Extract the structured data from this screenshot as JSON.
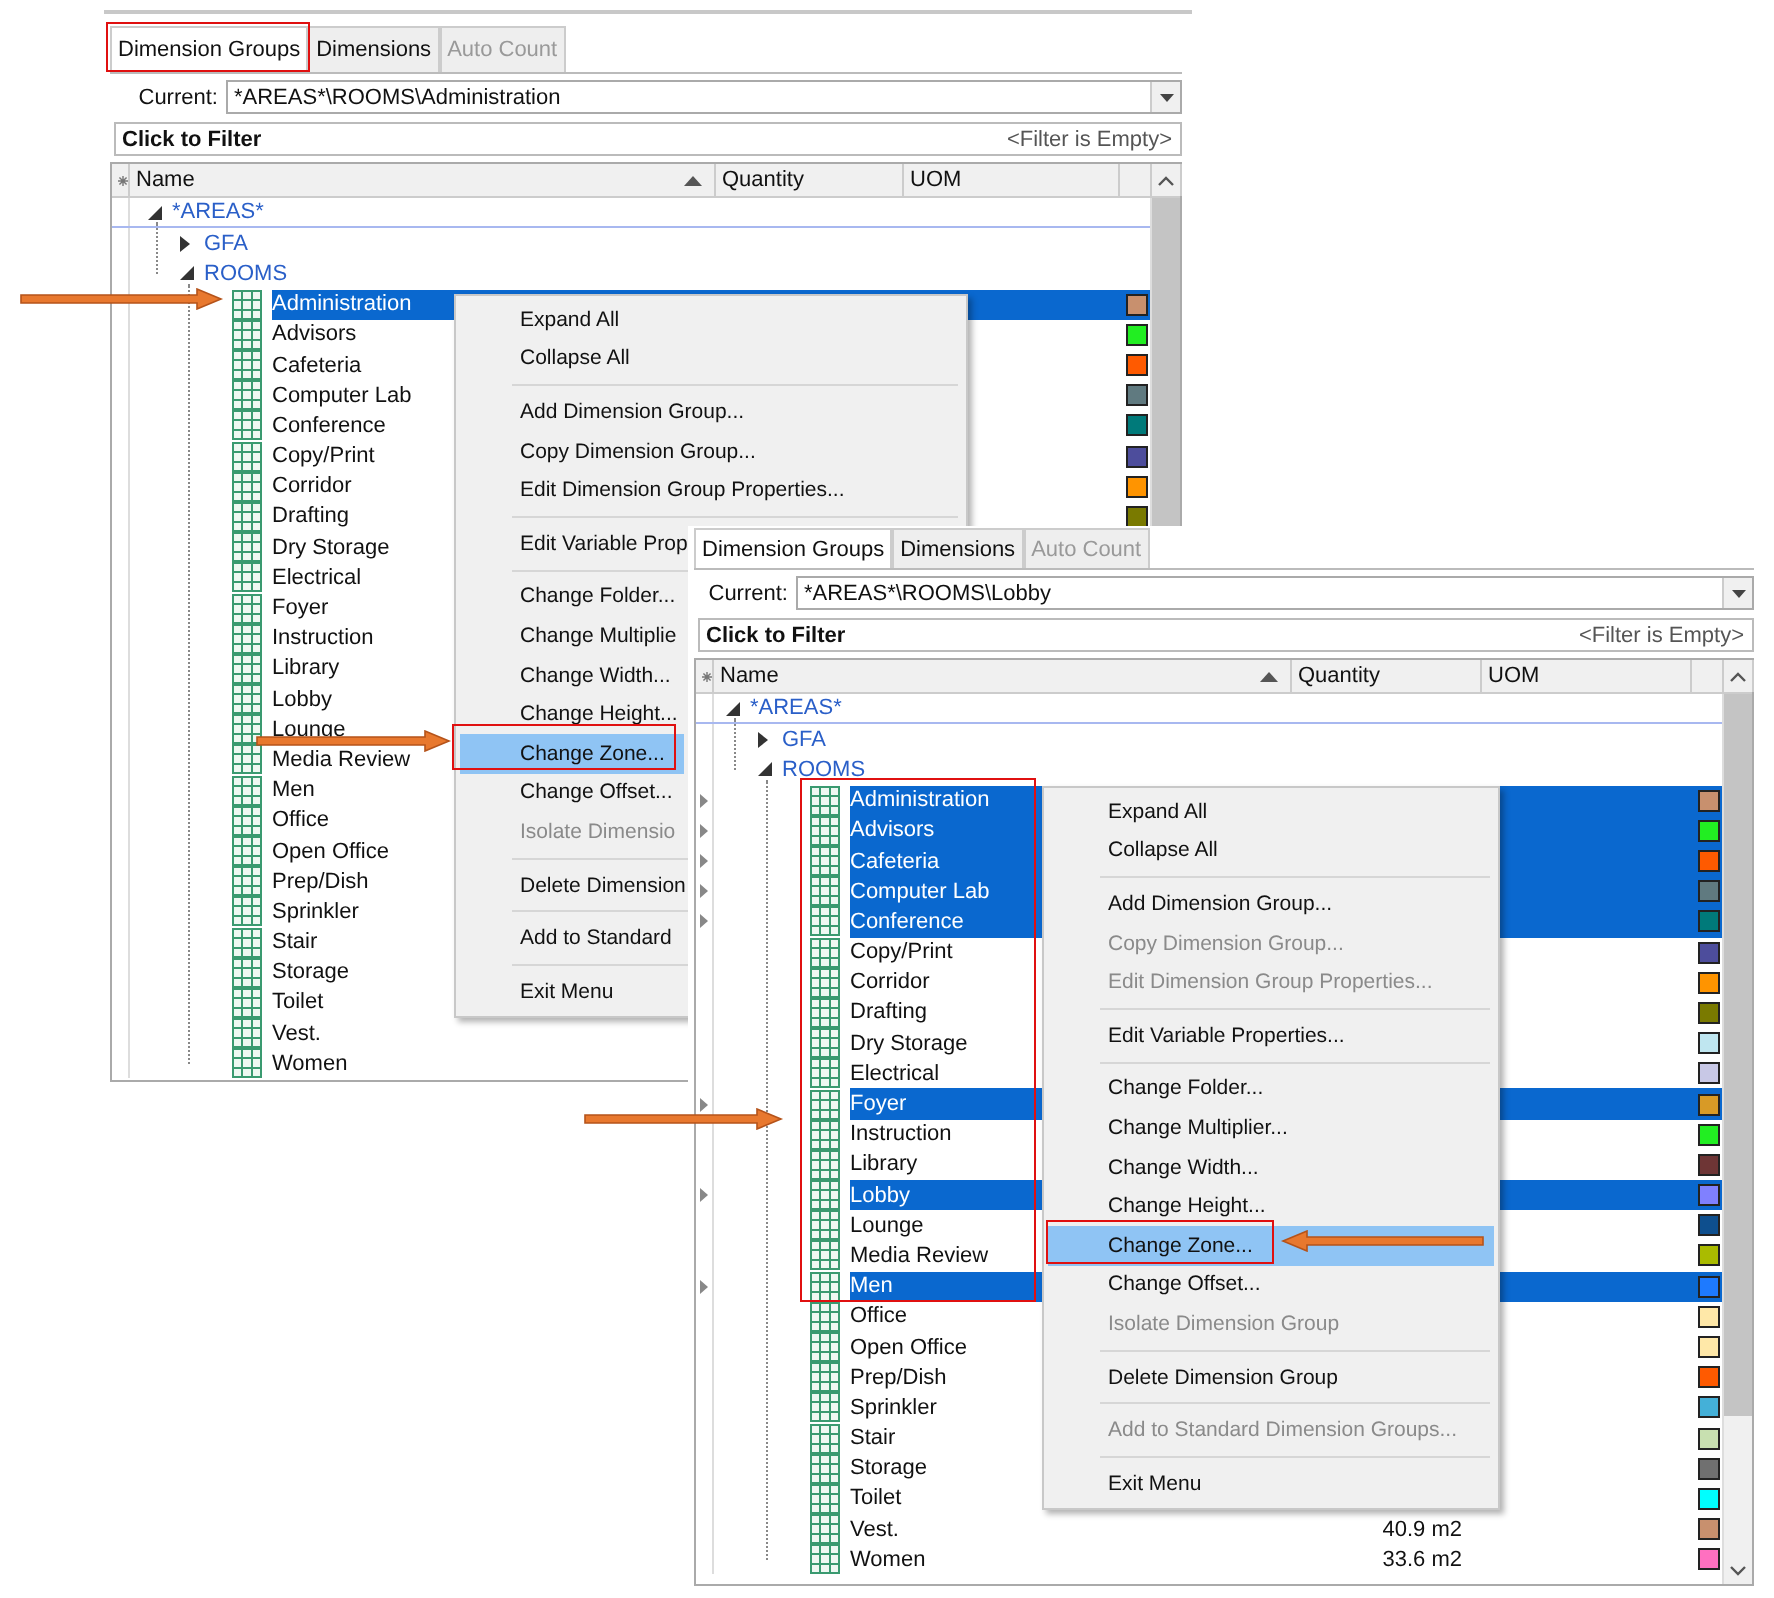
{
  "windows": [
    {
      "tabs": [
        {
          "label": "Dimension Groups",
          "selected": true,
          "disabled": false
        },
        {
          "label": "Dimensions",
          "selected": false,
          "disabled": false
        },
        {
          "label": "Auto Count",
          "selected": false,
          "disabled": true
        }
      ],
      "current_label": "Current:",
      "current_value": "*AREAS*\\ROOMS\\Administration",
      "filter_title": "Click to Filter",
      "filter_status": "<Filter is Empty>",
      "columns": [
        "Name",
        "Quantity",
        "UOM"
      ],
      "tree": [
        {
          "name": "*AREAS*",
          "expanded": true,
          "children": [
            {
              "name": "GFA",
              "expanded": false
            },
            {
              "name": "ROOMS",
              "expanded": true,
              "children": [
                {
                  "name": "Administration",
                  "selected": true,
                  "color": "#c8906e"
                },
                {
                  "name": "Advisors",
                  "selected": false,
                  "color": "#22ee22"
                },
                {
                  "name": "Cafeteria",
                  "selected": false,
                  "color": "#ff5a00"
                },
                {
                  "name": "Computer Lab",
                  "selected": false,
                  "color": "#607a80"
                },
                {
                  "name": "Conference",
                  "selected": false,
                  "color": "#007a7a"
                },
                {
                  "name": "Copy/Print",
                  "selected": false,
                  "color": "#4d4d9c"
                },
                {
                  "name": "Corridor",
                  "selected": false,
                  "color": "#ff9400"
                },
                {
                  "name": "Drafting",
                  "selected": false,
                  "color": "#7a7a00"
                },
                {
                  "name": "Dry Storage",
                  "selected": false
                },
                {
                  "name": "Electrical",
                  "selected": false
                },
                {
                  "name": "Foyer",
                  "selected": false
                },
                {
                  "name": "Instruction",
                  "selected": false
                },
                {
                  "name": "Library",
                  "selected": false
                },
                {
                  "name": "Lobby",
                  "selected": false
                },
                {
                  "name": "Lounge",
                  "selected": false
                },
                {
                  "name": "Media Review",
                  "selected": false
                },
                {
                  "name": "Men",
                  "selected": false
                },
                {
                  "name": "Office",
                  "selected": false
                },
                {
                  "name": "Open Office",
                  "selected": false
                },
                {
                  "name": "Prep/Dish",
                  "selected": false
                },
                {
                  "name": "Sprinkler",
                  "selected": false
                },
                {
                  "name": "Stair",
                  "selected": false
                },
                {
                  "name": "Storage",
                  "selected": false
                },
                {
                  "name": "Toilet",
                  "selected": false
                },
                {
                  "name": "Vest.",
                  "selected": false
                },
                {
                  "name": "Women",
                  "selected": false
                }
              ]
            }
          ]
        }
      ],
      "menu": [
        {
          "kind": "item",
          "label": "Expand All",
          "disabled": false,
          "highlighted": false
        },
        {
          "kind": "item",
          "label": "Collapse All",
          "disabled": false,
          "highlighted": false
        },
        {
          "kind": "separator"
        },
        {
          "kind": "item",
          "label": "Add Dimension Group...",
          "disabled": false,
          "highlighted": false
        },
        {
          "kind": "item",
          "label": "Copy Dimension Group...",
          "disabled": false,
          "highlighted": false
        },
        {
          "kind": "item",
          "label": "Edit Dimension Group Properties...",
          "disabled": false,
          "highlighted": false
        },
        {
          "kind": "separator"
        },
        {
          "kind": "item",
          "label": "Edit Variable Prop",
          "disabled": false,
          "highlighted": false
        },
        {
          "kind": "separator"
        },
        {
          "kind": "item",
          "label": "Change Folder...",
          "disabled": false,
          "highlighted": false
        },
        {
          "kind": "item",
          "label": "Change Multiplie",
          "disabled": false,
          "highlighted": false
        },
        {
          "kind": "item",
          "label": "Change Width...",
          "disabled": false,
          "highlighted": false
        },
        {
          "kind": "item",
          "label": "Change Height...",
          "disabled": false,
          "highlighted": false
        },
        {
          "kind": "item",
          "label": "Change Zone...",
          "disabled": false,
          "highlighted": true
        },
        {
          "kind": "item",
          "label": "Change Offset...",
          "disabled": false,
          "highlighted": false
        },
        {
          "kind": "item",
          "label": "Isolate Dimensio",
          "disabled": true,
          "highlighted": false
        },
        {
          "kind": "separator"
        },
        {
          "kind": "item",
          "label": "Delete Dimension",
          "disabled": false,
          "highlighted": false
        },
        {
          "kind": "separator"
        },
        {
          "kind": "item",
          "label": "Add to Standard",
          "disabled": false,
          "highlighted": false
        },
        {
          "kind": "separator"
        },
        {
          "kind": "item",
          "label": "Exit Menu",
          "disabled": false,
          "highlighted": false
        }
      ]
    },
    {
      "tabs": [
        {
          "label": "Dimension Groups",
          "selected": true,
          "disabled": false
        },
        {
          "label": "Dimensions",
          "selected": false,
          "disabled": false
        },
        {
          "label": "Auto Count",
          "selected": false,
          "disabled": true
        }
      ],
      "current_label": "Current:",
      "current_value": "*AREAS*\\ROOMS\\Lobby",
      "filter_title": "Click to Filter",
      "filter_status": "<Filter is Empty>",
      "columns": [
        "Name",
        "Quantity",
        "UOM"
      ],
      "tree": [
        {
          "name": "*AREAS*",
          "expanded": true,
          "children": [
            {
              "name": "GFA",
              "expanded": false
            },
            {
              "name": "ROOMS",
              "expanded": true,
              "children": [
                {
                  "name": "Administration",
                  "selected": true,
                  "color": "#c8906e"
                },
                {
                  "name": "Advisors",
                  "selected": true,
                  "color": "#22ee22"
                },
                {
                  "name": "Cafeteria",
                  "selected": true,
                  "color": "#ff5a00"
                },
                {
                  "name": "Computer Lab",
                  "selected": true,
                  "color": "#607a80"
                },
                {
                  "name": "Conference",
                  "selected": true,
                  "color": "#007a7a"
                },
                {
                  "name": "Copy/Print",
                  "selected": false,
                  "color": "#4d4d9c"
                },
                {
                  "name": "Corridor",
                  "selected": false,
                  "color": "#ff9400"
                },
                {
                  "name": "Drafting",
                  "selected": false,
                  "color": "#7a7a00"
                },
                {
                  "name": "Dry Storage",
                  "selected": false,
                  "color": "#bfe6f0"
                },
                {
                  "name": "Electrical",
                  "selected": false,
                  "color": "#c8c8e6"
                },
                {
                  "name": "Foyer",
                  "selected": true,
                  "color": "#d89a26"
                },
                {
                  "name": "Instruction",
                  "selected": false,
                  "color": "#22ee22"
                },
                {
                  "name": "Library",
                  "selected": false,
                  "color": "#6e3535"
                },
                {
                  "name": "Lobby",
                  "selected": true,
                  "color": "#8080ff"
                },
                {
                  "name": "Lounge",
                  "selected": false,
                  "color": "#0e4f8e"
                },
                {
                  "name": "Media Review",
                  "selected": false,
                  "color": "#aabb00"
                },
                {
                  "name": "Men",
                  "selected": true,
                  "color": "#1e7aff"
                },
                {
                  "name": "Office",
                  "selected": false,
                  "color": "#ffe8a8"
                },
                {
                  "name": "Open Office",
                  "selected": false,
                  "color": "#ffe8a8"
                },
                {
                  "name": "Prep/Dish",
                  "selected": false,
                  "color": "#ff5a00"
                },
                {
                  "name": "Sprinkler",
                  "selected": false,
                  "color": "#44b0d8"
                },
                {
                  "name": "Stair",
                  "selected": false,
                  "color": "#c8e0b0"
                },
                {
                  "name": "Storage",
                  "selected": false,
                  "color": "#707070"
                },
                {
                  "name": "Toilet",
                  "selected": false,
                  "color": "#00ffff"
                },
                {
                  "name": "Vest.",
                  "selected": false,
                  "color": "#c8906e",
                  "quantity": "40.9 m2"
                },
                {
                  "name": "Women",
                  "selected": false,
                  "color": "#ff70c0",
                  "quantity": "33.6 m2"
                }
              ]
            }
          ]
        }
      ],
      "menu": [
        {
          "kind": "item",
          "label": "Expand All",
          "disabled": false,
          "highlighted": false
        },
        {
          "kind": "item",
          "label": "Collapse All",
          "disabled": false,
          "highlighted": false
        },
        {
          "kind": "separator"
        },
        {
          "kind": "item",
          "label": "Add Dimension Group...",
          "disabled": false,
          "highlighted": false
        },
        {
          "kind": "item",
          "label": "Copy Dimension Group...",
          "disabled": true,
          "highlighted": false
        },
        {
          "kind": "item",
          "label": "Edit Dimension Group Properties...",
          "disabled": true,
          "highlighted": false
        },
        {
          "kind": "separator"
        },
        {
          "kind": "item",
          "label": "Edit Variable Properties...",
          "disabled": false,
          "highlighted": false
        },
        {
          "kind": "separator"
        },
        {
          "kind": "item",
          "label": "Change Folder...",
          "disabled": false,
          "highlighted": false
        },
        {
          "kind": "item",
          "label": "Change Multiplier...",
          "disabled": false,
          "highlighted": false
        },
        {
          "kind": "item",
          "label": "Change Width...",
          "disabled": false,
          "highlighted": false
        },
        {
          "kind": "item",
          "label": "Change Height...",
          "disabled": false,
          "highlighted": false
        },
        {
          "kind": "item",
          "label": "Change Zone...",
          "disabled": false,
          "highlighted": true
        },
        {
          "kind": "item",
          "label": "Change Offset...",
          "disabled": false,
          "highlighted": false
        },
        {
          "kind": "item",
          "label": "Isolate Dimension Group",
          "disabled": true,
          "highlighted": false
        },
        {
          "kind": "separator"
        },
        {
          "kind": "item",
          "label": "Delete Dimension Group",
          "disabled": false,
          "highlighted": false
        },
        {
          "kind": "separator"
        },
        {
          "kind": "item",
          "label": "Add to Standard Dimension Groups...",
          "disabled": true,
          "highlighted": false
        },
        {
          "kind": "separator"
        },
        {
          "kind": "item",
          "label": "Exit Menu",
          "disabled": false,
          "highlighted": false
        }
      ]
    }
  ]
}
